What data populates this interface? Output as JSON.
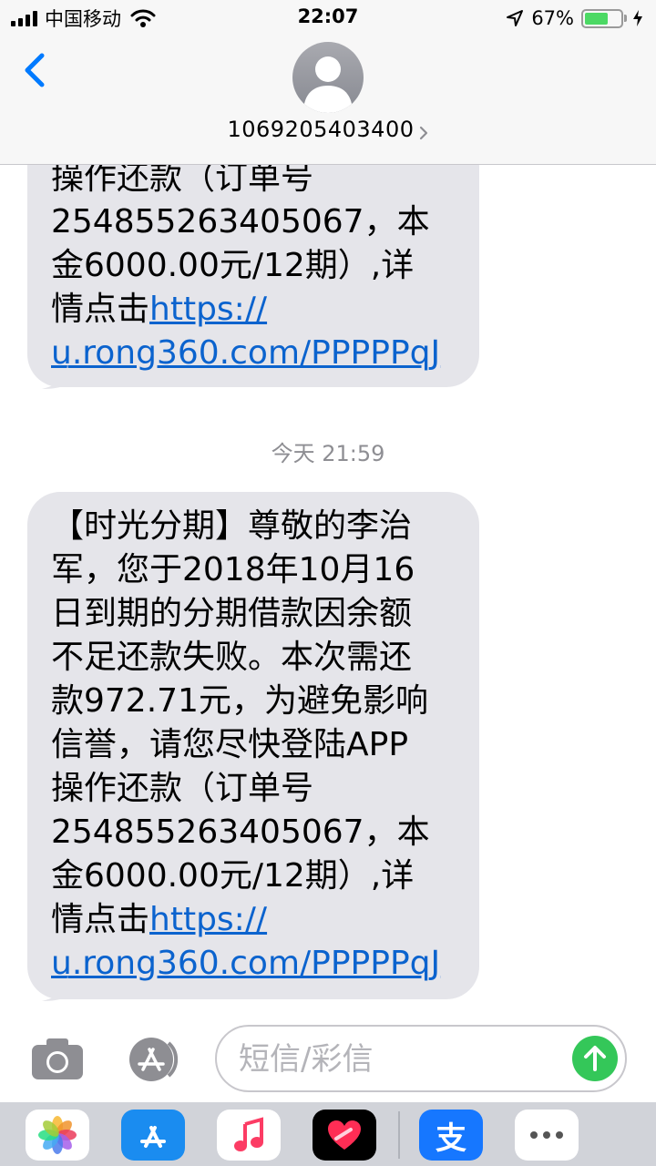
{
  "status_bar": {
    "carrier": "中国移动",
    "time": "22:07",
    "battery_percent_text": "67%",
    "battery_level": 0.67
  },
  "header": {
    "contact_number": "1069205403400",
    "back_icon": "chevron-left-icon",
    "avatar_icon": "person-silhouette-icon",
    "detail_icon": "chevron-right-icon"
  },
  "messages": {
    "previous": {
      "lines": [
        "操作还款（订单号",
        "254855263405067，本",
        "金6000.00元/12期）,详"
      ],
      "link_prefix": "情点击",
      "link_part1": "https://",
      "link_part2": "u.rong360.com/PPPPPqJ"
    },
    "timestamp": "今天 21:59",
    "main": {
      "lines": [
        "【时光分期】尊敬的李治",
        "军，您于2018年10月16",
        "日到期的分期借款因余额",
        "不足还款失败。本次需还",
        "款972.71元，为避免影响",
        "信誉，请您尽快登陆APP",
        "操作还款（订单号",
        "254855263405067，本",
        "金6000.00元/12期）,详"
      ],
      "link_prefix": "情点击",
      "link_part1": "https://",
      "link_part2": "u.rong360.com/PPPPPqJ"
    }
  },
  "input_bar": {
    "placeholder": "短信/彩信",
    "camera_icon": "camera-icon",
    "appstore_icon": "app-store-icon",
    "send_icon": "arrow-up-icon"
  },
  "app_drawer": {
    "apps": [
      "photos-icon",
      "app-store-icon",
      "music-icon",
      "digital-touch-icon",
      "alipay-icon",
      "more-icon"
    ],
    "alipay_glyph": "支"
  },
  "colors": {
    "bubble": "#e5e5ea",
    "link": "#0b63ce",
    "accent_blue": "#007aff",
    "send_green": "#34c759",
    "battery_green": "#4cd964"
  }
}
